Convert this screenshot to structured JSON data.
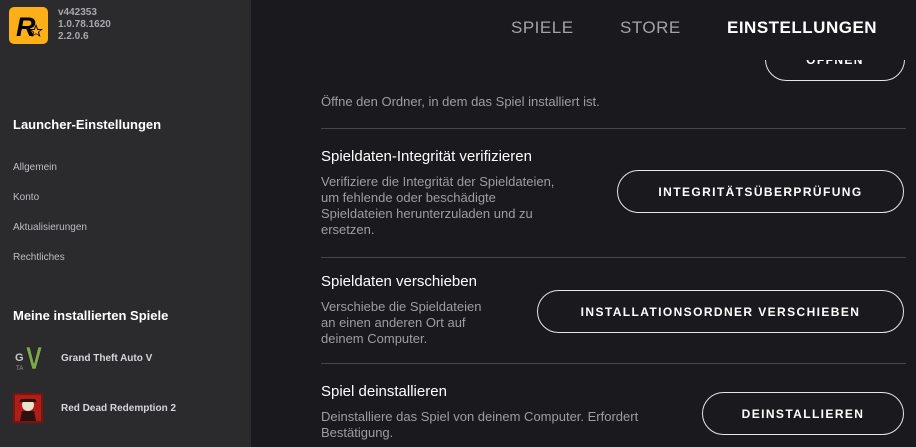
{
  "version": {
    "line1": "v442353",
    "line2": "1.0.78.1620",
    "line3": "2.2.0.6"
  },
  "topnav": {
    "games": "SPIELE",
    "store": "STORE",
    "settings": "EINSTELLUNGEN",
    "active": "settings"
  },
  "sidebar": {
    "launcher_title": "Launcher-Einstellungen",
    "items": [
      "Allgemein",
      "Konto",
      "Aktualisierungen",
      "Rechtliches"
    ],
    "games_title": "Meine installierten Spiele",
    "games": [
      {
        "name": "Grand Theft Auto V",
        "icon": "gta-v-icon"
      },
      {
        "name": "Red Dead Redemption 2",
        "icon": "rdr2-icon"
      }
    ]
  },
  "main": {
    "open_folder": {
      "desc": "Öffne den Ordner, in dem das Spiel installiert ist.",
      "button": "ÖFFNEN"
    },
    "verify": {
      "title": "Spieldaten-Integrität verifizieren",
      "desc_lines": [
        "Verifiziere die Integrität der Spieldateien,",
        "um fehlende oder beschädigte",
        "Spieldateien herunterzuladen und zu",
        "ersetzen."
      ],
      "button": "INTEGRITÄTSÜBERPRÜFUNG"
    },
    "move": {
      "title": "Spieldaten verschieben",
      "desc_lines": [
        "Verschiebe die Spieldateien",
        "an einen anderen Ort auf",
        "deinem Computer."
      ],
      "button": "INSTALLATIONSORDNER VERSCHIEBEN"
    },
    "uninstall": {
      "title": "Spiel deinstallieren",
      "desc_lines": [
        "Deinstalliere das Spiel von deinem Computer. Erfordert",
        "Bestätigung."
      ],
      "button": "DEINSTALLIEREN"
    }
  },
  "colors": {
    "background": "#1a1a1e",
    "sidebar": "#2b2b2e",
    "logo": "#fcaf17"
  }
}
